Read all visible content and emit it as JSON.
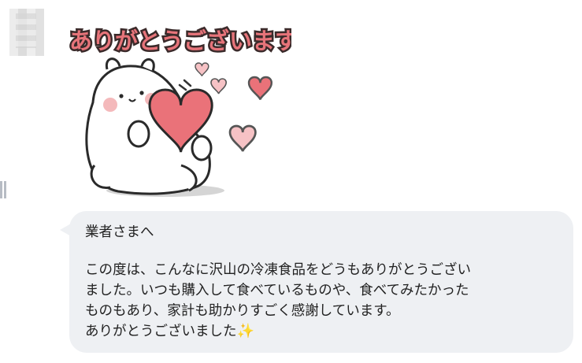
{
  "sticker": {
    "caption": "ありがとうございます",
    "colors": {
      "caption_fill": "#e7747a",
      "heart": "#ea7279",
      "heart_light": "#f6c2c5"
    }
  },
  "message": {
    "greeting": "業者さまへ",
    "lines": [
      "この度は、こんなに沢山の冷凍食品をどうもありがとうござい",
      "ました。いつも購入して食べているものや、食べてみたかった",
      "ものもあり、家計も助かりすごく感謝しています。",
      "ありがとうございました"
    ],
    "emoji": "✨"
  },
  "colors": {
    "bubble": "#eef0f3",
    "text": "#222222"
  }
}
